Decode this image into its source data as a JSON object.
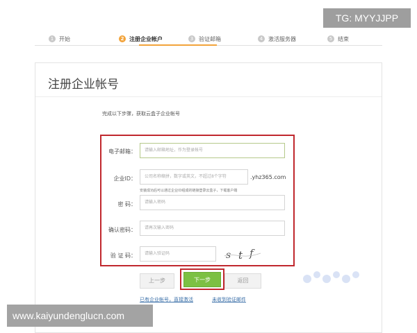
{
  "overlay": {
    "tg_label": "TG: MYYJJPP",
    "site_label": "www.kaiyundenglucn.com"
  },
  "steps": [
    {
      "num": "1",
      "label": "开始"
    },
    {
      "num": "2",
      "label": "注册企业帐户"
    },
    {
      "num": "3",
      "label": "验证邮箱"
    },
    {
      "num": "4",
      "label": "激活服务器"
    },
    {
      "num": "5",
      "label": "结束"
    }
  ],
  "panel": {
    "title": "注册企业帐号",
    "intro": "完成以下步骤，获取云盒子企业帐号"
  },
  "form": {
    "email_label": "电子邮箱：",
    "email_placeholder": "请输入邮箱地址，作为登录帐号",
    "company_label": "企业ID：",
    "company_placeholder": "公司名称缩拼，数字或英文，不超过8个字符",
    "company_domain": ".yhz365.com",
    "company_hint": "安装成功后可以通过企业ID组成的链接登录云盒子，下载客户端",
    "password_label": "密      码：",
    "password_placeholder": "请输入密码",
    "confirm_label": "确认密码：",
    "confirm_placeholder": "请再次输入密码",
    "captcha_label": "验 证 码：",
    "captcha_placeholder": "请输入验证码",
    "captcha_chars": [
      "s",
      "t",
      "f"
    ]
  },
  "buttons": {
    "prev": "上一步",
    "next": "下一步",
    "back": "返回"
  },
  "links": {
    "has_account": "已有企业帐号，直接激活",
    "no_email": "未收到验证邮件"
  },
  "colors": {
    "accent_orange": "#f2a33a",
    "highlight_red": "#c0272d",
    "next_green": "#7cc043"
  }
}
